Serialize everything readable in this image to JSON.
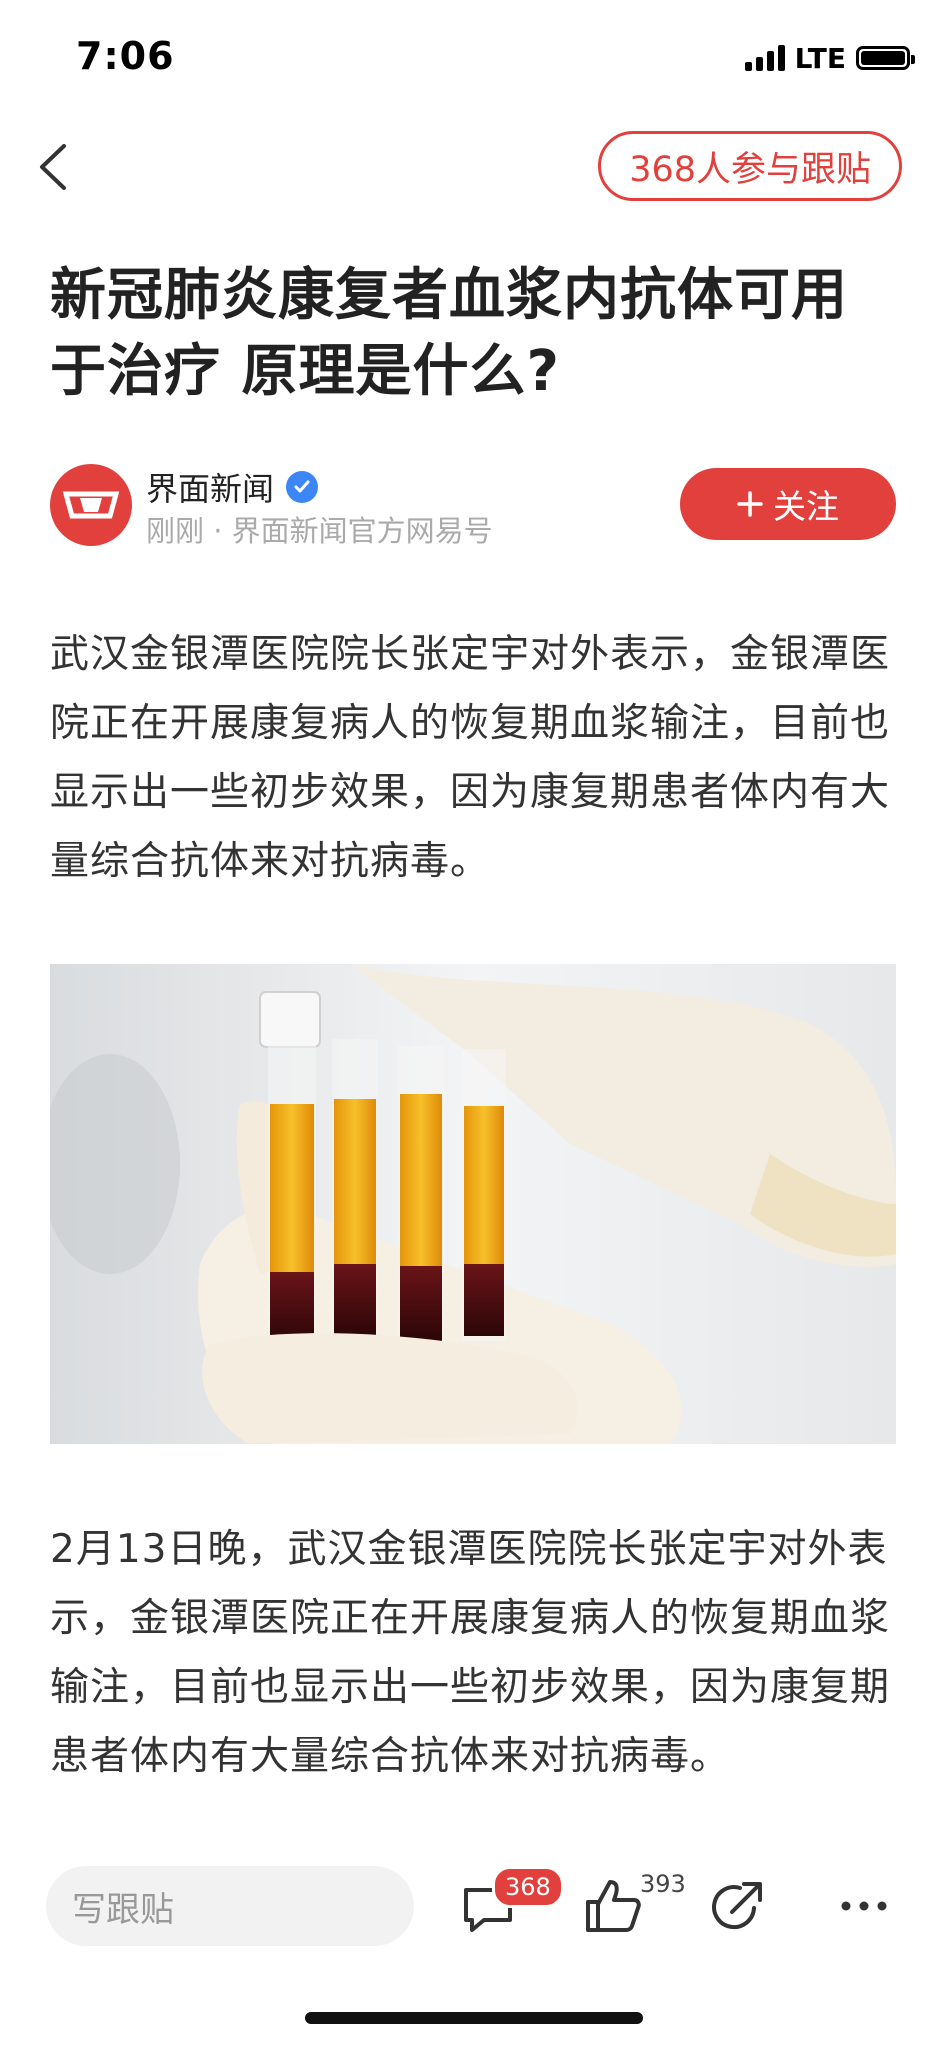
{
  "status_bar": {
    "time": "7:06",
    "network": "LTE"
  },
  "header": {
    "follow_count_label": "368人参与跟贴"
  },
  "article": {
    "title_line1": "新冠肺炎康复者血浆内抗体可用",
    "title_line2": "于治疗 原理是什么?",
    "author": {
      "name": "界面新闻",
      "meta": "刚刚 · 界面新闻官方网易号",
      "follow_label": "关注"
    },
    "paragraph1": "武汉金银潭医院院长张定宇对外表示，金银潭医院正在开展康复病人的恢复期血浆输注，目前也显示出一些初步效果，因为康复期患者体内有大量综合抗体来对抗病毒。",
    "paragraph2": "2月13日晚，武汉金银潭医院院长张定宇对外表示，金银潭医院正在开展康复病人的恢复期血浆输注，目前也显示出一些初步效果，因为康复期患者体内有大量综合抗体来对抗病毒。"
  },
  "bottom_bar": {
    "comment_placeholder": "写跟贴",
    "comment_count": "368",
    "like_count": "393"
  },
  "colors": {
    "accent": "#e2403d",
    "verified": "#3d86f5"
  }
}
